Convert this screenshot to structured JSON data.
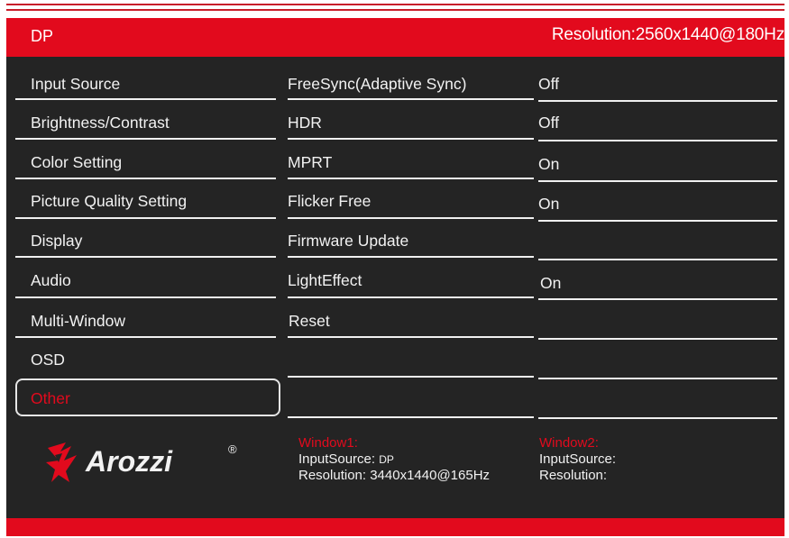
{
  "header": {
    "input": "DP",
    "resolution_label": "Resolution:",
    "resolution_value": "2560x1440@180Hz"
  },
  "menu": [
    {
      "label": "Input Source"
    },
    {
      "label": "Brightness/Contrast"
    },
    {
      "label": "Color Setting"
    },
    {
      "label": "Picture Quality Setting"
    },
    {
      "label": "Display"
    },
    {
      "label": "Audio"
    },
    {
      "label": "Multi-Window"
    },
    {
      "label": "OSD"
    },
    {
      "label": "Other",
      "selected": true
    }
  ],
  "submenu": [
    {
      "label": "FreeSync(Adaptive Sync)",
      "value": "Off"
    },
    {
      "label": "HDR",
      "value": "Off"
    },
    {
      "label": "MPRT",
      "value": "On"
    },
    {
      "label": "Flicker Free",
      "value": "On"
    },
    {
      "label": "Firmware Update",
      "value": ""
    },
    {
      "label": "LightEffect",
      "value": "On"
    },
    {
      "label": "Reset",
      "value": ""
    }
  ],
  "window1": {
    "title": "Window1:",
    "input_label": "InputSource:",
    "input_value": "DP",
    "res_label": "Resolution:",
    "res_value": "3440x1440@165Hz"
  },
  "window2": {
    "title": "Window2:",
    "input_label": "InputSource:",
    "res_label": "Resolution:"
  },
  "brand": {
    "name": "Arozzi",
    "mark": "®"
  },
  "colors": {
    "accent": "#e20a1d",
    "background": "#242424",
    "text": "#f2f2f2"
  }
}
